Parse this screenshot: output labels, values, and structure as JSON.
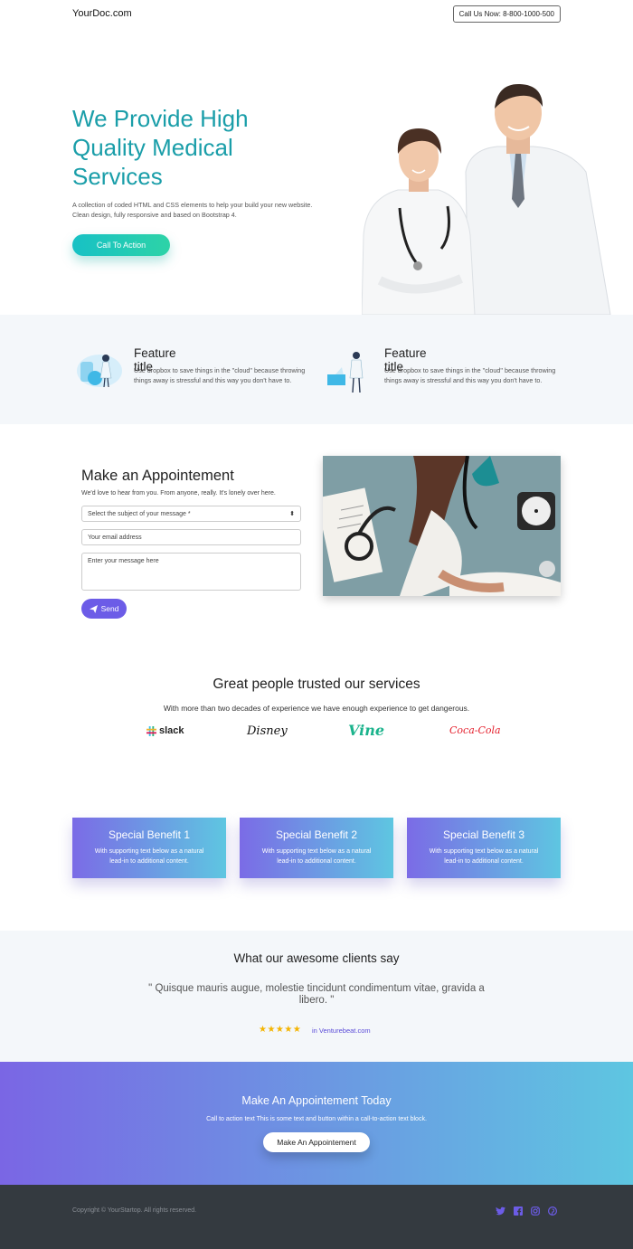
{
  "header": {
    "brand": "YourDoc.com",
    "phone_button": "Call Us Now: 8-800-1000-500"
  },
  "hero": {
    "title": "We Provide High Quality Medical Services",
    "text": "A collection of coded HTML and CSS elements to help your build your new website. Clean design, fully responsive and based on Bootstrap 4.",
    "cta": "Call To Action"
  },
  "features": [
    {
      "title": "Feature title",
      "text": "Use dropbox to save things in the \"cloud\" because throwing things away is stressful and this way you don't have to.",
      "icon": "lab-illustration-icon"
    },
    {
      "title": "Feature title",
      "text": "Use dropbox to save things in the \"cloud\" because throwing things away is stressful and this way you don't have to.",
      "icon": "doctor-illustration-icon"
    }
  ],
  "appointment": {
    "title": "Make an Appointement",
    "subtitle": "We'd love to hear from you. From anyone, really. It's lonely over here.",
    "subject_placeholder": "Select the subject of your message *",
    "email_placeholder": "Your email address",
    "message_placeholder": "Enter your message here",
    "send": "Send"
  },
  "trusted": {
    "title": "Great people trusted our services",
    "subtitle": "With more than two decades of experience we have enough experience to get dangerous.",
    "logos": [
      {
        "name": "slack"
      },
      {
        "name": "Disney"
      },
      {
        "name": "Vine"
      },
      {
        "name": "Coca-Cola"
      }
    ]
  },
  "benefits": [
    {
      "title": "Special Benefit 1",
      "text": "With supporting text below as a natural lead-in to additional content."
    },
    {
      "title": "Special Benefit 2",
      "text": "With supporting text below as a natural lead-in to additional content."
    },
    {
      "title": "Special Benefit 3",
      "text": "With supporting text below as a natural lead-in to additional content."
    }
  ],
  "testimonial": {
    "title": "What our awesome clients say",
    "quote": "\" Quisque mauris augue, molestie tincidunt condimentum vitae, gravida a libero. \"",
    "stars": "★★★★★",
    "rating": 5,
    "source": "in Venturebeat.com"
  },
  "cta_band": {
    "title": "Make An Appointement Today",
    "text": "Call to action text This is some text and button within a call-to-action text block.",
    "button": "Make An Appointement"
  },
  "footer": {
    "copyright": "Copyright © YourStartop. All rights reserved.",
    "social": [
      "twitter-icon",
      "facebook-icon",
      "instagram-icon",
      "pinterest-icon"
    ]
  },
  "colors": {
    "accent_teal": "#1a9ea9",
    "brand_purple": "#6c5ce7",
    "gradient_start": "#7a66e4",
    "gradient_end": "#5ec6e1",
    "footer_bg": "#343a40"
  }
}
